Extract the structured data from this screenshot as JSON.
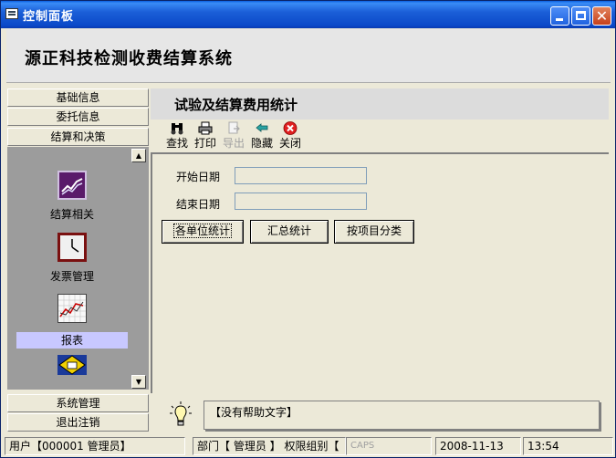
{
  "window": {
    "title": "控制面板"
  },
  "header": {
    "system_title": "源正科技检测收费结算系统"
  },
  "sidebar": {
    "top_nav": [
      "基础信息",
      "委托信息",
      "结算和决策"
    ],
    "panel_items": [
      {
        "label": "结算相关",
        "icon": "stock-chart-icon"
      },
      {
        "label": "发票管理",
        "icon": "clock-icon"
      },
      {
        "label": "报表",
        "icon": "line-graph-icon",
        "selected": true
      },
      {
        "label": "",
        "icon": "printer-sign-icon"
      }
    ],
    "bottom_nav": [
      "系统管理",
      "退出注销"
    ]
  },
  "content": {
    "title": "试验及结算费用统计",
    "toolbar": [
      {
        "label": "查找",
        "icon": "binoculars-icon",
        "enabled": true
      },
      {
        "label": "打印",
        "icon": "printer-icon",
        "enabled": true
      },
      {
        "label": "导出",
        "icon": "export-icon",
        "enabled": false
      },
      {
        "label": "隐藏",
        "icon": "back-arrow-icon",
        "enabled": true
      },
      {
        "label": "关闭",
        "icon": "close-red-icon",
        "enabled": true
      }
    ],
    "form": {
      "start_date_label": "开始日期",
      "start_date_value": "",
      "end_date_label": "结束日期",
      "end_date_value": ""
    },
    "buttons": [
      "各单位统计",
      "汇总统计",
      "按项目分类"
    ]
  },
  "help": {
    "text": "【没有帮助文字】"
  },
  "statusbar": {
    "user": "用户【000001 管理员】",
    "department": "部门【 管理员 】 权限组别【",
    "caps": "CAPS",
    "date": "2008-11-13",
    "time": "13:54"
  },
  "colors": {
    "title_bar": "#0b49c9",
    "panel_bg": "#9c9c9c",
    "selected_item": "#c8c8ff"
  }
}
